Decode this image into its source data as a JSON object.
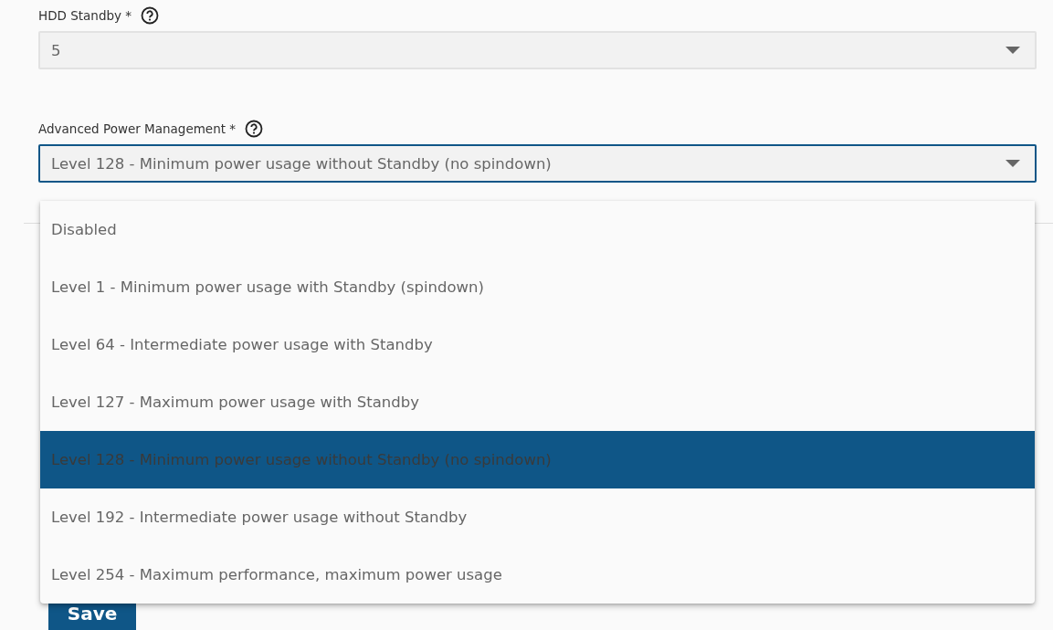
{
  "fields": [
    {
      "label": "HDD Standby *",
      "value": "5",
      "focused": false
    },
    {
      "label": "Advanced Power Management *",
      "value": "Level 128 - Minimum power usage without Standby (no spindown)",
      "focused": true
    }
  ],
  "dropdown": {
    "options": [
      {
        "label": "Disabled",
        "selected": false
      },
      {
        "label": "Level 1 - Minimum power usage with Standby (spindown)",
        "selected": false
      },
      {
        "label": "Level 64 - Intermediate power usage with Standby",
        "selected": false
      },
      {
        "label": "Level 127 - Maximum power usage with Standby",
        "selected": false
      },
      {
        "label": "Level 128 - Minimum power usage without Standby (no spindown)",
        "selected": true
      },
      {
        "label": "Level 192 - Intermediate power usage without Standby",
        "selected": false
      },
      {
        "label": "Level 254 - Maximum performance, maximum power usage",
        "selected": false
      }
    ]
  },
  "save_button": "Save"
}
